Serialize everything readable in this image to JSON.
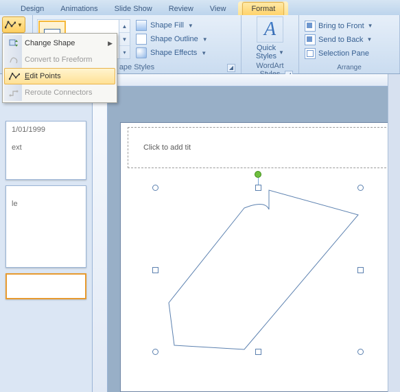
{
  "tabs": {
    "design": "Design",
    "animations": "Animations",
    "slideshow": "Slide Show",
    "review": "Review",
    "view": "View",
    "format": "Format"
  },
  "ribbon": {
    "shape_styles_label": "ape Styles",
    "shape_fill": "Shape Fill",
    "shape_outline": "Shape Outline",
    "shape_effects": "Shape Effects",
    "wordart_label": "WordArt Styles",
    "quick_styles": "Quick\nStyles",
    "bring_front": "Bring to Front",
    "send_back": "Send to Back",
    "selection_pane": "Selection Pane",
    "arrange_label": "Arrange"
  },
  "menu": {
    "change_shape": "Change Shape",
    "convert_freeform": "Convert to Freeform",
    "edit_points_pre": "E",
    "edit_points_rest": "dit Points",
    "reroute": "Reroute Connectors"
  },
  "thumbs": {
    "date": "1/01/1999",
    "ext": "ext",
    "le": "le"
  },
  "canvas": {
    "title_placeholder": "Click to add tit"
  }
}
